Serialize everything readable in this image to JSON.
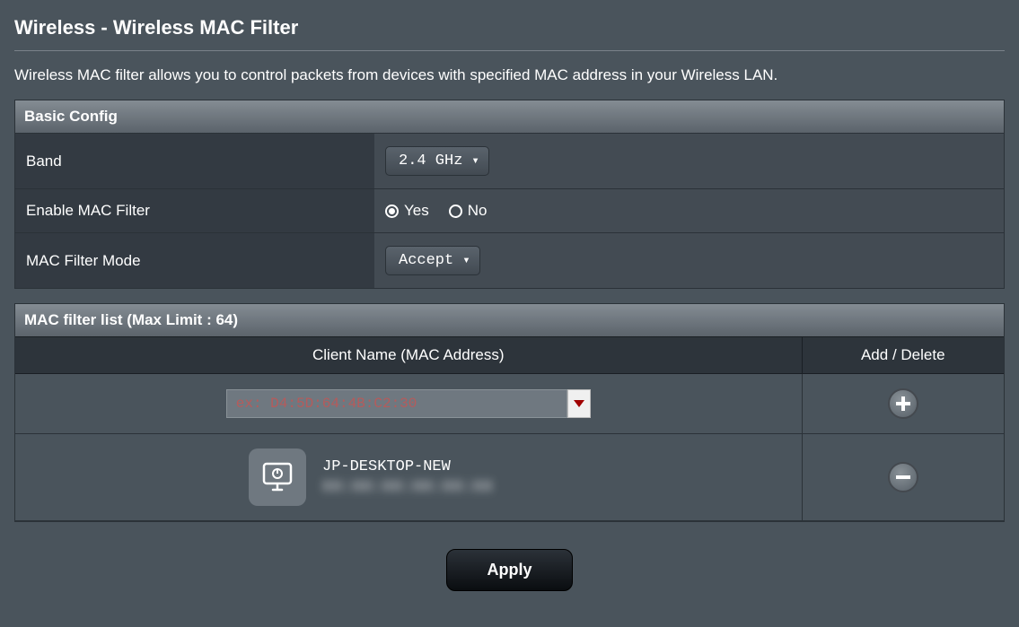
{
  "page": {
    "title": "Wireless - Wireless MAC Filter",
    "description": "Wireless MAC filter allows you to control packets from devices with specified MAC address in your Wireless LAN."
  },
  "basic_config": {
    "header": "Basic Config",
    "band": {
      "label": "Band",
      "value": "2.4 GHz"
    },
    "enable": {
      "label": "Enable MAC Filter",
      "yes": "Yes",
      "no": "No",
      "selected": "yes"
    },
    "mode": {
      "label": "MAC Filter Mode",
      "value": "Accept"
    }
  },
  "mac_list": {
    "header": "MAC filter list (Max Limit : 64)",
    "col_client": "Client Name (MAC Address)",
    "col_action": "Add / Delete",
    "input_placeholder": "ex: D4:5D:64:4B:C2:30",
    "entries": [
      {
        "name": "JP-DESKTOP-NEW",
        "mac": "XX:XX:XX:XX:XX:XX"
      }
    ]
  },
  "buttons": {
    "apply": "Apply"
  }
}
